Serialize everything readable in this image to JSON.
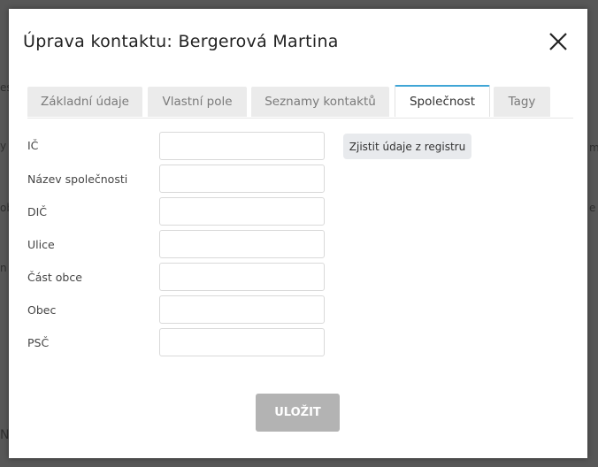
{
  "modal": {
    "title": "Úprava kontaktu: Bergerová Martina"
  },
  "tabs": [
    {
      "label": "Základní údaje"
    },
    {
      "label": "Vlastní pole"
    },
    {
      "label": "Seznamy kontaktů"
    },
    {
      "label": "Společnost",
      "active": true
    },
    {
      "label": "Tagy"
    }
  ],
  "form": {
    "fields": [
      {
        "label": "IČ",
        "value": ""
      },
      {
        "label": "Název společnosti",
        "value": ""
      },
      {
        "label": "DIČ",
        "value": ""
      },
      {
        "label": "Ulice",
        "value": ""
      },
      {
        "label": "Část obce",
        "value": ""
      },
      {
        "label": "Obec",
        "value": ""
      },
      {
        "label": "PSČ",
        "value": ""
      }
    ],
    "lookup_label": "Zjistit údaje z registru",
    "save_label": "ULOŽIT"
  },
  "colors": {
    "active_tab_accent": "#3fa5d6",
    "save_button": "#b3b3b3",
    "overlay": "#575757"
  }
}
